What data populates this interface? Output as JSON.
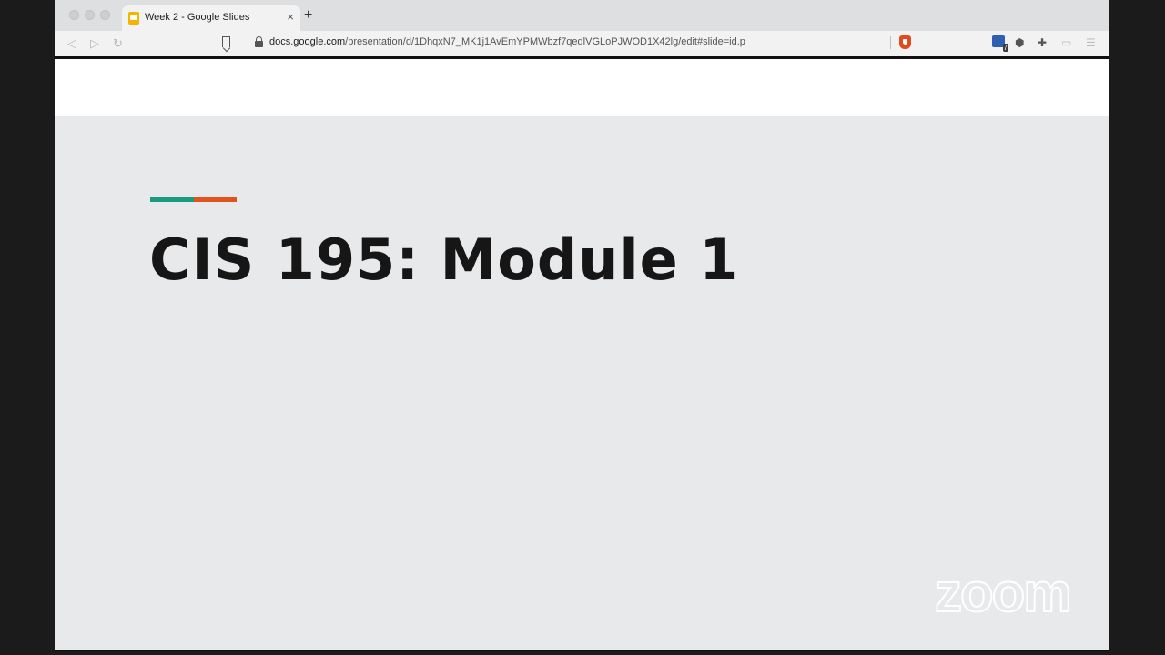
{
  "browser": {
    "tab_title": "Week 2 - Google Slides",
    "tab_close": "×",
    "new_tab": "+",
    "url_host": "docs.google.com",
    "url_path": "/presentation/d/1DhqxN7_MK1j1AvEmYPMWbzf7qedlVGLoPJWOD1X42lg/edit#slide=id.p",
    "extension_badge": "7",
    "icons": [
      "back-icon",
      "forward-icon",
      "reload-icon",
      "bookmark-icon",
      "lock-icon",
      "brave-shield-icon",
      "extension-icon",
      "cube-icon",
      "puzzle-icon",
      "cast-icon",
      "menu-icon"
    ]
  },
  "slide": {
    "title": "CIS 195: Module 1",
    "accent_colors": [
      "#1a9a7f",
      "#e0521e"
    ]
  },
  "watermark": {
    "text": "zoom"
  }
}
